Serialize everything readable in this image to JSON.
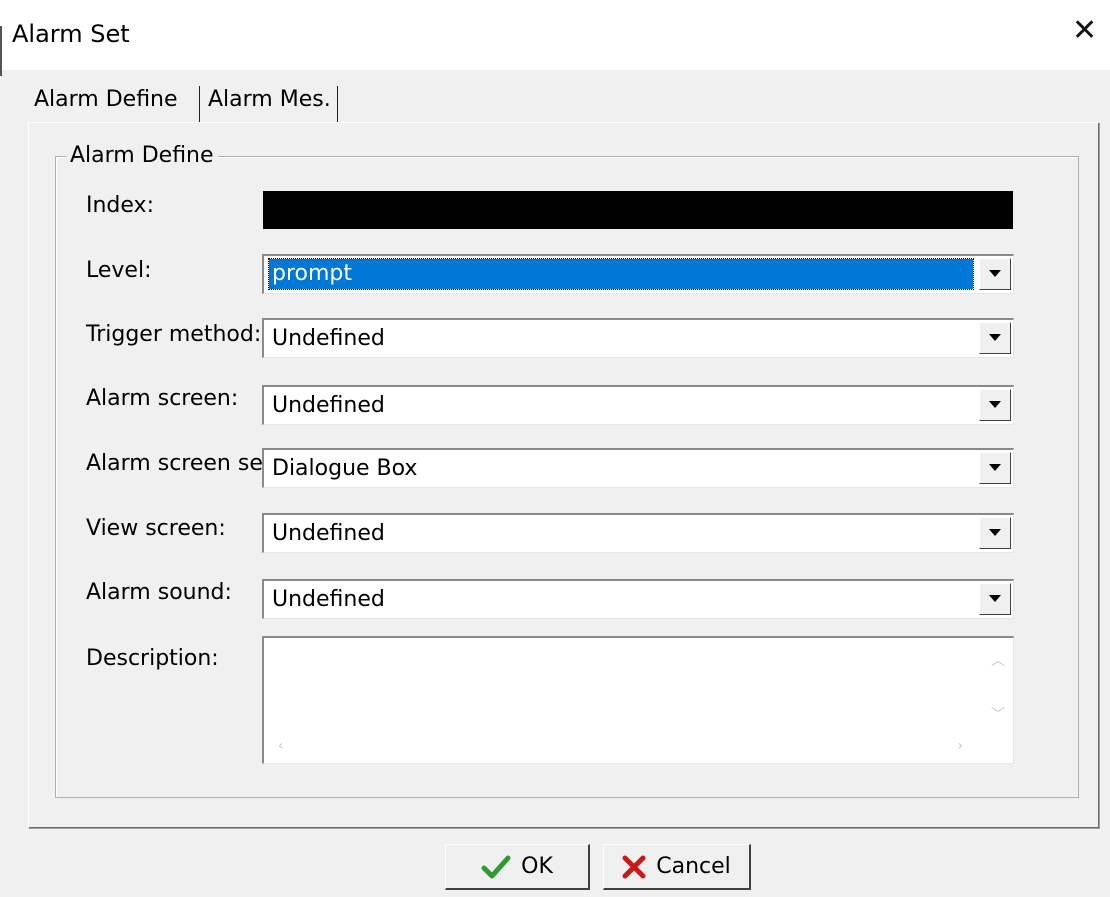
{
  "window": {
    "title": "Alarm Set",
    "close_glyph": "✕"
  },
  "tabs": [
    {
      "label": "Alarm Define",
      "active": true
    },
    {
      "label": "Alarm Mes.",
      "active": false
    }
  ],
  "group": {
    "title": "Alarm Define"
  },
  "fields": {
    "index": {
      "label": "Index:"
    },
    "level": {
      "label": "Level:",
      "value": "prompt"
    },
    "trigger_method": {
      "label": "Trigger method:",
      "value": "Undefined"
    },
    "alarm_screen": {
      "label": "Alarm screen:",
      "value": "Undefined"
    },
    "alarm_screen_set": {
      "label": "Alarm screen set",
      "value": "Dialogue Box"
    },
    "view_screen": {
      "label": "View screen:",
      "value": "Undefined"
    },
    "alarm_sound": {
      "label": "Alarm sound:",
      "value": "Undefined"
    },
    "description": {
      "label": "Description:",
      "value": ""
    }
  },
  "buttons": {
    "ok": {
      "label": "OK",
      "icon": "checkmark-icon"
    },
    "cancel": {
      "label": "Cancel",
      "icon": "x-icon"
    }
  },
  "colors": {
    "selection": "#0078d7",
    "ok_icon": "#2e9b2e",
    "cancel_icon": "#c81818",
    "index_field": "#000000"
  }
}
